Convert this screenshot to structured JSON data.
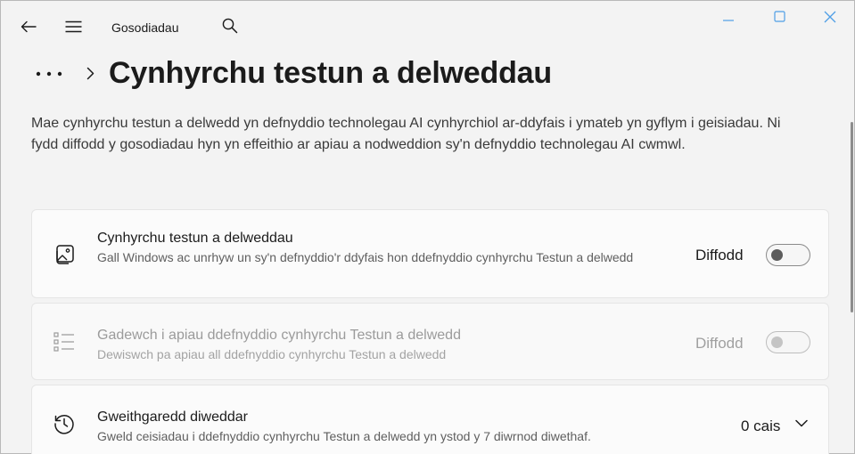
{
  "window": {
    "app_title": "Gosodiadau",
    "icons": {
      "back": "back-arrow-icon",
      "menu": "hamburger-menu-icon",
      "search": "search-icon",
      "minimize": "minimize-icon",
      "maximize": "maximize-icon",
      "close": "close-icon"
    },
    "accent": "#0067c0"
  },
  "header": {
    "breadcrumb_more": "•••",
    "page_title": "Cynhyrchu testun a delweddau"
  },
  "description": "Mae cynhyrchu testun a delwedd yn defnyddio technolegau AI cynhyrchiol ar-ddyfais i ymateb yn gyflym i geisiadau. Ni fydd diffodd y gosodiadau hyn yn effeithio ar apiau a nodweddion sy'n defnyddio technolegau AI cwmwl.",
  "cards": [
    {
      "icon": "image-icon",
      "title": "Cynhyrchu testun a delweddau",
      "subtitle": "Gall Windows ac unrhyw un sy'n defnyddio'r ddyfais hon ddefnyddio cynhyrchu Testun a delwedd",
      "state_label": "Diffodd",
      "toggle_on": false,
      "enabled": true
    },
    {
      "icon": "list-icon",
      "title": "Gadewch i apiau ddefnyddio cynhyrchu Testun a delwedd",
      "subtitle": "Dewiswch pa apiau all ddefnyddio cynhyrchu Testun a delwedd",
      "state_label": "Diffodd",
      "toggle_on": false,
      "enabled": false
    },
    {
      "icon": "history-icon",
      "title": "Gweithgaredd diweddar",
      "subtitle": "Gweld ceisiadau i ddefnyddio cynhyrchu Testun a delwedd yn ystod y 7 diwrnod diwethaf.",
      "count_label": "0 cais",
      "expand_icon": "chevron-down-icon"
    }
  ]
}
